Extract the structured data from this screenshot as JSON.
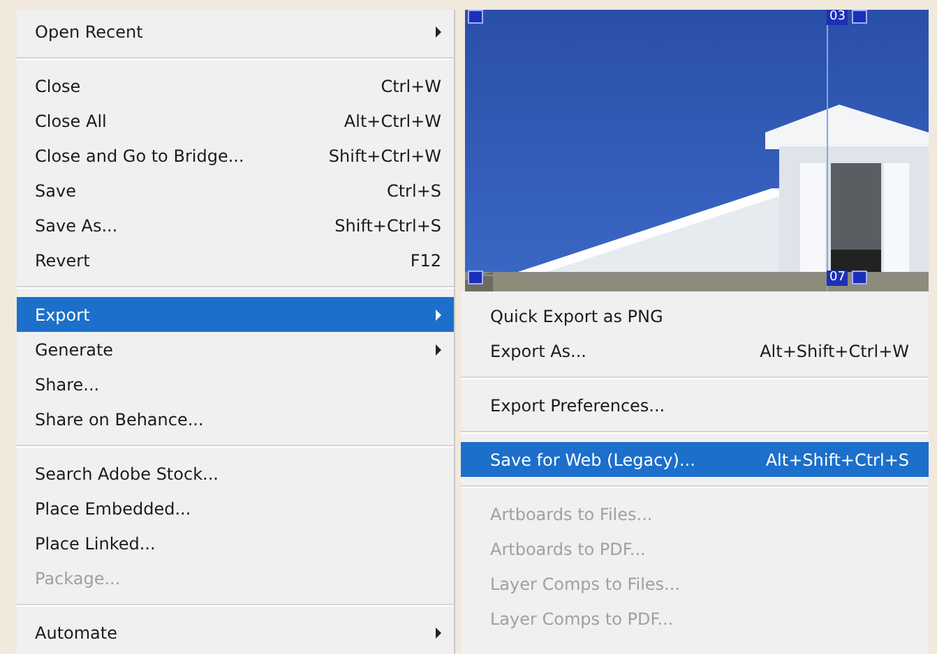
{
  "file_menu": {
    "items": [
      {
        "kind": "item",
        "label": "Open Recent",
        "submenu": true,
        "selected": false,
        "disabled": false
      },
      {
        "kind": "separator"
      },
      {
        "kind": "item",
        "label": "Close",
        "shortcut": "Ctrl+W",
        "submenu": false,
        "selected": false,
        "disabled": false
      },
      {
        "kind": "item",
        "label": "Close All",
        "shortcut": "Alt+Ctrl+W",
        "submenu": false,
        "selected": false,
        "disabled": false
      },
      {
        "kind": "item",
        "label": "Close and Go to Bridge...",
        "shortcut": "Shift+Ctrl+W",
        "submenu": false,
        "selected": false,
        "disabled": false
      },
      {
        "kind": "item",
        "label": "Save",
        "shortcut": "Ctrl+S",
        "submenu": false,
        "selected": false,
        "disabled": false
      },
      {
        "kind": "item",
        "label": "Save As...",
        "shortcut": "Shift+Ctrl+S",
        "submenu": false,
        "selected": false,
        "disabled": false
      },
      {
        "kind": "item",
        "label": "Revert",
        "shortcut": "F12",
        "submenu": false,
        "selected": false,
        "disabled": false
      },
      {
        "kind": "separator"
      },
      {
        "kind": "item",
        "label": "Export",
        "submenu": true,
        "selected": true,
        "disabled": false
      },
      {
        "kind": "item",
        "label": "Generate",
        "submenu": true,
        "selected": false,
        "disabled": false
      },
      {
        "kind": "item",
        "label": "Share...",
        "submenu": false,
        "selected": false,
        "disabled": false
      },
      {
        "kind": "item",
        "label": "Share on Behance...",
        "submenu": false,
        "selected": false,
        "disabled": false
      },
      {
        "kind": "separator"
      },
      {
        "kind": "item",
        "label": "Search Adobe Stock...",
        "submenu": false,
        "selected": false,
        "disabled": false
      },
      {
        "kind": "item",
        "label": "Place Embedded...",
        "submenu": false,
        "selected": false,
        "disabled": false
      },
      {
        "kind": "item",
        "label": "Place Linked...",
        "submenu": false,
        "selected": false,
        "disabled": false
      },
      {
        "kind": "item",
        "label": "Package...",
        "submenu": false,
        "selected": false,
        "disabled": true
      },
      {
        "kind": "separator"
      },
      {
        "kind": "item",
        "label": "Automate",
        "submenu": true,
        "selected": false,
        "disabled": false
      }
    ]
  },
  "canvas": {
    "kind": "picture",
    "slices": [
      {
        "number": "03"
      },
      {
        "number": "07"
      }
    ]
  },
  "export_submenu": {
    "items": [
      {
        "kind": "item",
        "label": "Quick Export as PNG",
        "selected": false,
        "disabled": false
      },
      {
        "kind": "item",
        "label": "Export As...",
        "shortcut": "Alt+Shift+Ctrl+W",
        "selected": false,
        "disabled": false
      },
      {
        "kind": "separator"
      },
      {
        "kind": "item",
        "label": "Export Preferences...",
        "selected": false,
        "disabled": false
      },
      {
        "kind": "separator"
      },
      {
        "kind": "item",
        "label": "Save for Web (Legacy)...",
        "shortcut": "Alt+Shift+Ctrl+S",
        "selected": true,
        "disabled": false
      },
      {
        "kind": "separator"
      },
      {
        "kind": "item",
        "label": "Artboards to Files...",
        "selected": false,
        "disabled": true
      },
      {
        "kind": "item",
        "label": "Artboards to PDF...",
        "selected": false,
        "disabled": true
      },
      {
        "kind": "item",
        "label": "Layer Comps to Files...",
        "selected": false,
        "disabled": true
      },
      {
        "kind": "item",
        "label": "Layer Comps to PDF...",
        "selected": false,
        "disabled": true
      }
    ]
  }
}
